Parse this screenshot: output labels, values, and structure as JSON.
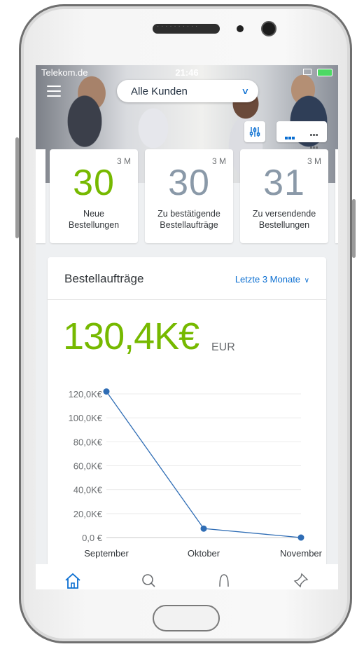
{
  "status_bar": {
    "carrier": "Telekom.de",
    "time": "21:46"
  },
  "header": {
    "customer_select": "Alle Kunden",
    "icons": [
      "menu-icon",
      "filter-icon",
      "cards-view-icon",
      "grid-view-icon"
    ]
  },
  "kpis": [
    {
      "period": "3 M",
      "value": "30",
      "label_line1": "Neue",
      "label_line2": "Bestellungen",
      "color": "#76b900"
    },
    {
      "period": "3 M",
      "value": "30",
      "label_line1": "Zu bestätigende",
      "label_line2": "Bestellaufträge",
      "color": "#8a99a8"
    },
    {
      "period": "3 M",
      "value": "31",
      "label_line1": "Zu versendende",
      "label_line2": "Bestellungen",
      "color": "#8a99a8"
    }
  ],
  "sales_orders": {
    "title": "Bestellaufträge",
    "range": "Letzte 3 Monate",
    "total": "130,4K€",
    "currency": "EUR"
  },
  "chart_data": {
    "type": "line",
    "categories": [
      "September",
      "Oktober",
      "November"
    ],
    "series": [
      {
        "values": [
          122000,
          7500,
          0
        ]
      }
    ],
    "ylim": [
      0,
      120000
    ],
    "y_ticks": [
      "0,0 €",
      "20,0K€",
      "40,0K€",
      "60,0K€",
      "80,0K€",
      "100,0K€",
      "120,0K€"
    ],
    "y_tick_values": [
      0,
      20000,
      40000,
      60000,
      80000,
      100000,
      120000
    ],
    "grid": true,
    "color": "#2f6db5"
  },
  "tabbar": {
    "icons": [
      "home-icon",
      "search-icon",
      "notifications-icon",
      "pin-icon"
    ]
  },
  "colors": {
    "accent": "#0a6ed1",
    "positive": "#76b900",
    "neutral": "#8a99a8"
  }
}
